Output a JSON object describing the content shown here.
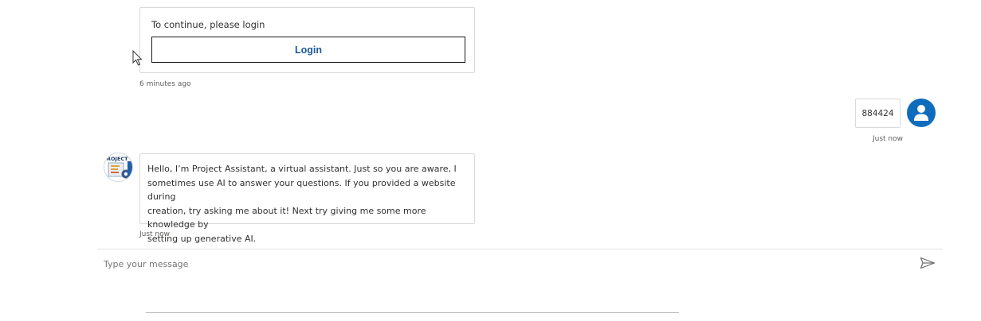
{
  "login_card": {
    "prompt": "To continue, please login",
    "button_label": "Login",
    "timestamp": "6 minutes ago"
  },
  "user_message": {
    "text": "884424",
    "timestamp": "Just now",
    "avatar_icon": "person-icon",
    "avatar_color": "#0f6cbd"
  },
  "bot_message": {
    "avatar_text": "ROJECT",
    "text_lines": [
      "Hello, I’m Project Assistant, a virtual assistant. Just so you are aware, I",
      "sometimes use AI to answer your questions. If you provided a website during",
      "creation, try asking me about it! Next try giving me some more knowledge by",
      "setting up generative AI."
    ],
    "timestamp": "Just now"
  },
  "composer": {
    "placeholder": "Type your message",
    "send_icon": "send-icon"
  }
}
